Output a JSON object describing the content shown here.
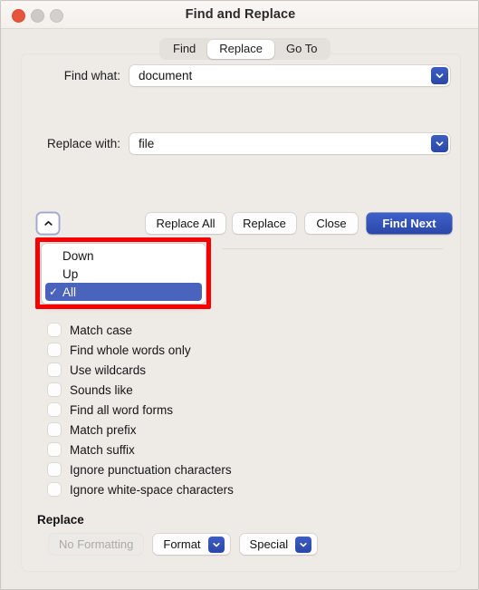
{
  "window": {
    "title": "Find and Replace",
    "traffic_lights": [
      "close-button",
      "minimize-button",
      "maximize-button"
    ]
  },
  "tabs": [
    {
      "label": "Find",
      "active": false
    },
    {
      "label": "Replace",
      "active": true
    },
    {
      "label": "Go To",
      "active": false
    }
  ],
  "fields": {
    "find": {
      "label": "Find what:",
      "value": "document",
      "placeholder": ""
    },
    "replace": {
      "label": "Replace with:",
      "value": "file",
      "placeholder": ""
    }
  },
  "buttons": {
    "direction_toggle": "chevron-up",
    "replace_all": "Replace All",
    "replace": "Replace",
    "close": "Close",
    "find_next": "Find Next"
  },
  "dropdown": {
    "open": true,
    "items": [
      {
        "label": "Down",
        "selected": false,
        "check": ""
      },
      {
        "label": "Up",
        "selected": false,
        "check": ""
      },
      {
        "label": "All",
        "selected": true,
        "check": "✓"
      }
    ]
  },
  "options": [
    {
      "label": "Match case",
      "checked": false
    },
    {
      "label": "Find whole words only",
      "checked": false
    },
    {
      "label": "Use wildcards",
      "checked": false
    },
    {
      "label": "Sounds like",
      "checked": false
    },
    {
      "label": "Find all word forms",
      "checked": false
    },
    {
      "label": "Match prefix",
      "checked": false
    },
    {
      "label": "Match suffix",
      "checked": false
    },
    {
      "label": "Ignore punctuation characters",
      "checked": false
    },
    {
      "label": "Ignore white-space characters",
      "checked": false
    }
  ],
  "footer": {
    "section_title": "Replace",
    "no_formatting": "No Formatting",
    "format": "Format",
    "special": "Special"
  },
  "colors": {
    "accent_blue": "#2c47aa",
    "selection_blue": "#4a63bd",
    "annotation_red": "#f90000",
    "window_bg": "#edeae6",
    "panel_bg": "#eeebe7",
    "close_red": "#e8553d"
  }
}
